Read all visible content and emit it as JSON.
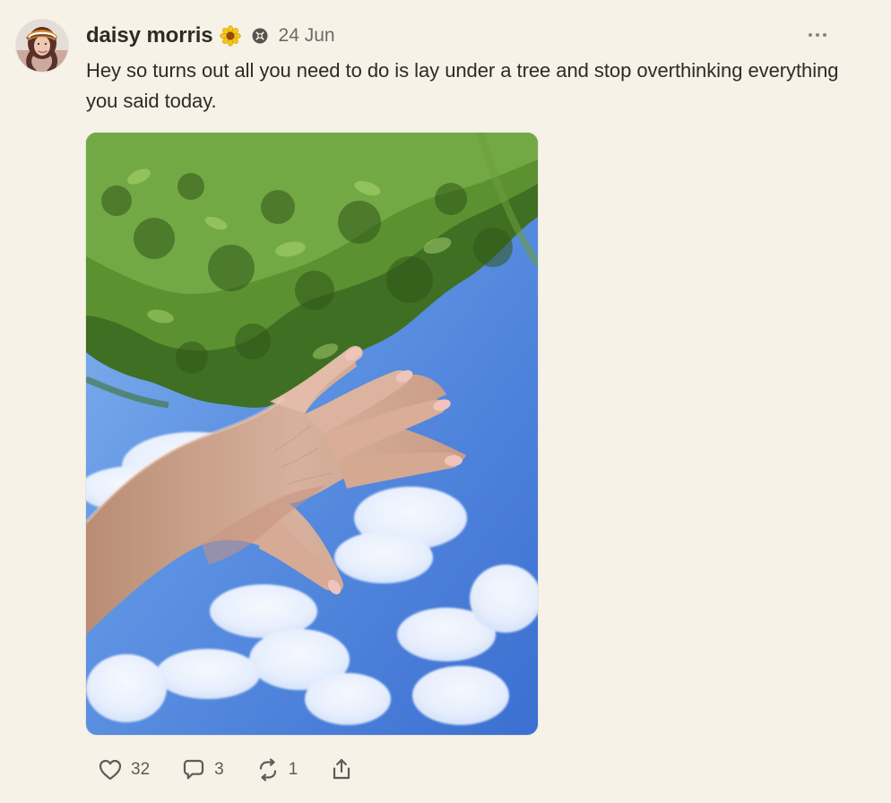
{
  "post": {
    "author": {
      "name": "daisy morris",
      "emoji_icon": "sunflower-emoji-icon",
      "badge_icon": "verified-badge-icon"
    },
    "date": "24 Jun",
    "text": "Hey so turns out all you need to do is lay under a tree and stop overthinking everything you said today.",
    "media": {
      "icon": "photo",
      "description_colors": {
        "sky": "#5f95e6",
        "foliage": "#4e7f2a",
        "skin": "#d9b6a1"
      }
    },
    "actions": {
      "like": {
        "icon": "heart-icon",
        "count": "32"
      },
      "comment": {
        "icon": "comment-icon",
        "count": "3"
      },
      "repost": {
        "icon": "repost-icon",
        "count": "1"
      },
      "share": {
        "icon": "share-icon"
      }
    }
  },
  "colors": {
    "background": "#f6f2e7",
    "text": "#2f2a26",
    "muted": "#6f6a65"
  }
}
